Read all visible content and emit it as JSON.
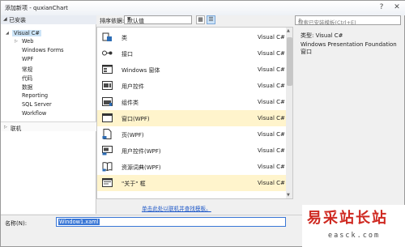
{
  "window": {
    "title": "添加新项 - quxianChart",
    "help": "?",
    "close": "✕"
  },
  "sidebar": {
    "installed": "已安装",
    "items": [
      {
        "label": "Visual C#",
        "selected": true
      },
      {
        "label": "Web"
      },
      {
        "label": "Windows Forms"
      },
      {
        "label": "WPF"
      },
      {
        "label": "常规"
      },
      {
        "label": "代码"
      },
      {
        "label": "数据"
      },
      {
        "label": "Reporting"
      },
      {
        "label": "SQL Server"
      },
      {
        "label": "Workflow"
      }
    ],
    "online": "联机"
  },
  "toolbar": {
    "sort_label": "排序依据:",
    "sort_value": "默认值",
    "search_placeholder": "搜索已安装模板(Ctrl+E)"
  },
  "templates": [
    {
      "name": "类",
      "lang": "Visual C#",
      "icon": "class-icon"
    },
    {
      "name": "接口",
      "lang": "Visual C#",
      "icon": "interface-icon"
    },
    {
      "name": "Windows 窗体",
      "lang": "Visual C#",
      "icon": "windows-form-icon"
    },
    {
      "name": "用户控件",
      "lang": "Visual C#",
      "icon": "user-control-icon"
    },
    {
      "name": "组件类",
      "lang": "Visual C#",
      "icon": "component-class-icon"
    },
    {
      "name": "窗口(WPF)",
      "lang": "Visual C#",
      "icon": "wpf-window-icon",
      "selected": true
    },
    {
      "name": "页(WPF)",
      "lang": "Visual C#",
      "icon": "wpf-page-icon"
    },
    {
      "name": "用户控件(WPF)",
      "lang": "Visual C#",
      "icon": "wpf-user-control-icon"
    },
    {
      "name": "资源词典(WPF)",
      "lang": "Visual C#",
      "icon": "resource-dictionary-icon"
    },
    {
      "name": "\"关于\" 框",
      "lang": "Visual C#",
      "icon": "about-box-icon"
    }
  ],
  "online_link": "单击此处以联机并查找模板。",
  "description": {
    "type_label": "类型:",
    "type_value": "Visual C#",
    "text": "Windows Presentation Foundation 窗口"
  },
  "footer": {
    "name_label": "名称(N):",
    "name_value": "Window1.xaml"
  },
  "watermark": {
    "big": "易采站长站",
    "small": "easck.com"
  }
}
